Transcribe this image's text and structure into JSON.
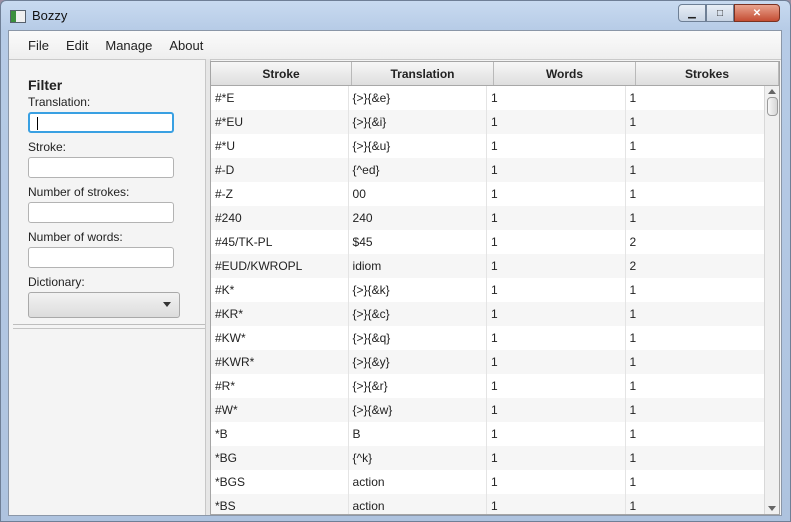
{
  "window": {
    "title": "Bozzy"
  },
  "menu": {
    "items": [
      "File",
      "Edit",
      "Manage",
      "About"
    ]
  },
  "filter": {
    "title": "Filter",
    "translation_label": "Translation:",
    "translation_value": "",
    "stroke_label": "Stroke:",
    "stroke_value": "",
    "num_strokes_label": "Number of strokes:",
    "num_strokes_value": "",
    "num_words_label": "Number of words:",
    "num_words_value": "",
    "dictionary_label": "Dictionary:",
    "dictionary_value": ""
  },
  "table": {
    "columns": [
      "Stroke",
      "Translation",
      "Words",
      "Strokes"
    ],
    "rows": [
      [
        "#*E",
        "{>}{&e}",
        "1",
        "1"
      ],
      [
        "#*EU",
        "{>}{&i}",
        "1",
        "1"
      ],
      [
        "#*U",
        "{>}{&u}",
        "1",
        "1"
      ],
      [
        "#-D",
        "{^ed}",
        "1",
        "1"
      ],
      [
        "#-Z",
        "00",
        "1",
        "1"
      ],
      [
        "#240",
        "240",
        "1",
        "1"
      ],
      [
        "#45/TK-PL",
        "$45",
        "1",
        "2"
      ],
      [
        "#EUD/KWROPL",
        "idiom",
        "1",
        "2"
      ],
      [
        "#K*",
        "{>}{&k}",
        "1",
        "1"
      ],
      [
        "#KR*",
        "{>}{&c}",
        "1",
        "1"
      ],
      [
        "#KW*",
        "{>}{&q}",
        "1",
        "1"
      ],
      [
        "#KWR*",
        "{>}{&y}",
        "1",
        "1"
      ],
      [
        "#R*",
        "{>}{&r}",
        "1",
        "1"
      ],
      [
        "#W*",
        "{>}{&w}",
        "1",
        "1"
      ],
      [
        "*B",
        "B",
        "1",
        "1"
      ],
      [
        "*BG",
        "{^k}",
        "1",
        "1"
      ],
      [
        "*BGS",
        "action",
        "1",
        "1"
      ],
      [
        "*BS",
        "action",
        "1",
        "1"
      ]
    ]
  },
  "icons": {
    "app": "app-icon",
    "minimize": "minimize-icon",
    "maximize": "maximize-icon",
    "close": "close-icon",
    "dropdown": "chevron-down-icon"
  }
}
